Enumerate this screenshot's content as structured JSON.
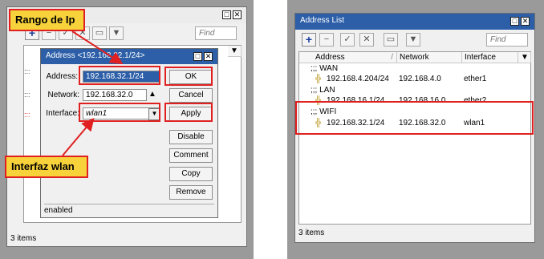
{
  "left": {
    "bg_window": {
      "title": "",
      "find_placeholder": "Find",
      "status": "3 items"
    },
    "dialog": {
      "title": "Address <192.168.32.1/24>",
      "fields": {
        "address_label": "Address:",
        "address_value": "192.168.32.1/24",
        "network_label": "Network:",
        "network_value": "192.168.32.0",
        "interface_label": "Interface:",
        "interface_value": "wlan1"
      },
      "buttons": [
        "OK",
        "Cancel",
        "Apply",
        "Disable",
        "Comment",
        "Copy",
        "Remove"
      ],
      "status": "enabled"
    },
    "callouts": {
      "ip_range": "Rango de Ip",
      "interface": "Interfaz wlan"
    },
    "highlight_color": "#e02020",
    "callout_color": "#f7d23a"
  },
  "right": {
    "window": {
      "title": "Address List",
      "find_placeholder": "Find",
      "status": "3 items"
    },
    "columns": [
      "Address",
      "Network",
      "Interface"
    ],
    "groups": [
      {
        "comment": ";;; WAN",
        "address": "192.168.4.204/24",
        "network": "192.168.4.0",
        "interface": "ether1"
      },
      {
        "comment": ";;; LAN",
        "address": "192.168.16.1/24",
        "network": "192.168.16.0",
        "interface": "ether2"
      },
      {
        "comment": ";;; WIFI",
        "address": "192.168.32.1/24",
        "network": "192.168.32.0",
        "interface": "wlan1"
      }
    ]
  }
}
